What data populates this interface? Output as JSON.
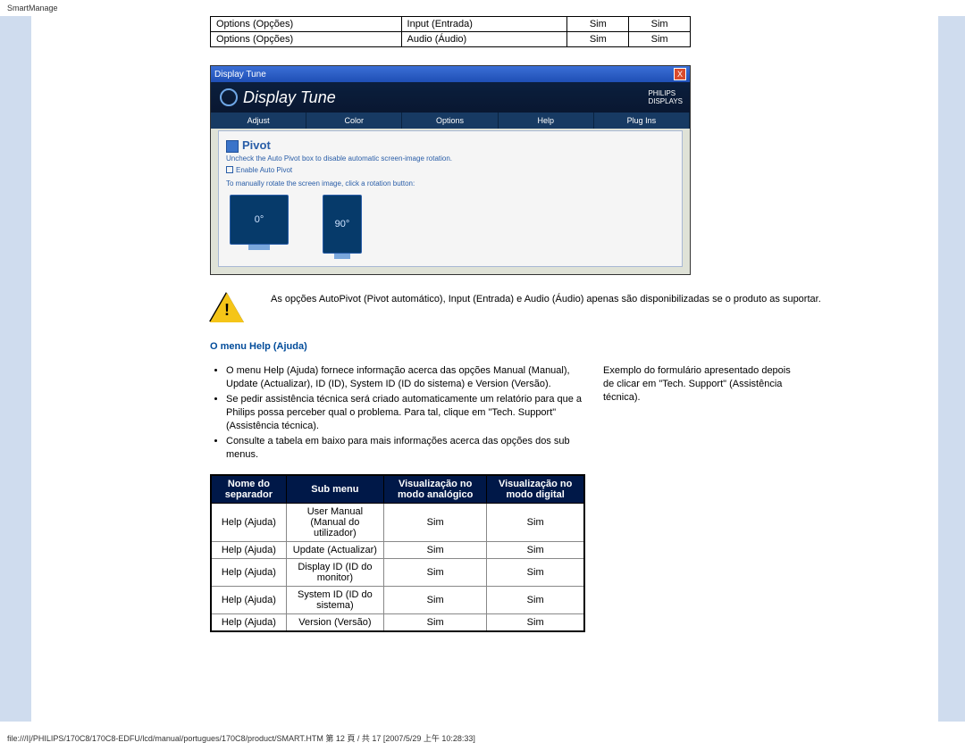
{
  "header": "SmartManage",
  "top_table": {
    "rows": [
      [
        "Options (Opções)",
        "Input (Entrada)",
        "Sim",
        "Sim"
      ],
      [
        "Options (Opções)",
        "Audio (Áudio)",
        "Sim",
        "Sim"
      ]
    ]
  },
  "screenshot": {
    "titlebar": "Display Tune",
    "close": "X",
    "banner_title": "Display Tune",
    "brand_line1": "PHILIPS",
    "brand_line2": "DISPLAYS",
    "tabs": [
      "Adjust",
      "Color",
      "Options",
      "Help",
      "Plug Ins"
    ],
    "pivot_heading": "Pivot",
    "pivot_sub": "Uncheck the Auto Pivot box to disable automatic screen-image rotation.",
    "pivot_checkbox": "Enable Auto Pivot",
    "pivot_text": "To manually rotate the screen image, click a rotation button:",
    "mon0": "0°",
    "mon90": "90°"
  },
  "note": "As opções AutoPivot (Pivot automático), Input (Entrada) e Audio (Áudio) apenas são disponibilizadas se o produto as suportar.",
  "section_title": "O menu Help (Ajuda)",
  "bullets": [
    "O menu Help (Ajuda) fornece informação acerca das opções Manual (Manual), Update (Actualizar), ID (ID), System ID (ID do sistema) e Version (Versão).",
    "Se pedir assistência técnica será criado automaticamente um relatório para que a Philips possa perceber qual o problema. Para tal, clique em \"Tech. Support\" (Assistência técnica).",
    "Consulte a tabela em baixo para mais informações acerca das opções dos sub menus."
  ],
  "right_text": "Exemplo do formulário apresentado depois de clicar em \"Tech. Support\" (Assistência técnica).",
  "help_table": {
    "headers": [
      "Nome do separador",
      "Sub menu",
      "Visualização no modo analógico",
      "Visualização no modo digital"
    ],
    "rows": [
      [
        "Help (Ajuda)",
        "User Manual (Manual do utilizador)",
        "Sim",
        "Sim"
      ],
      [
        "Help (Ajuda)",
        "Update (Actualizar)",
        "Sim",
        "Sim"
      ],
      [
        "Help (Ajuda)",
        "Display ID (ID do monitor)",
        "Sim",
        "Sim"
      ],
      [
        "Help (Ajuda)",
        "System ID (ID do sistema)",
        "Sim",
        "Sim"
      ],
      [
        "Help (Ajuda)",
        "Version (Versão)",
        "Sim",
        "Sim"
      ]
    ]
  },
  "footer": "file:///I|/PHILIPS/170C8/170C8-EDFU/lcd/manual/portugues/170C8/product/SMART.HTM 第 12 頁 / 共 17 [2007/5/29 上午 10:28:33]"
}
